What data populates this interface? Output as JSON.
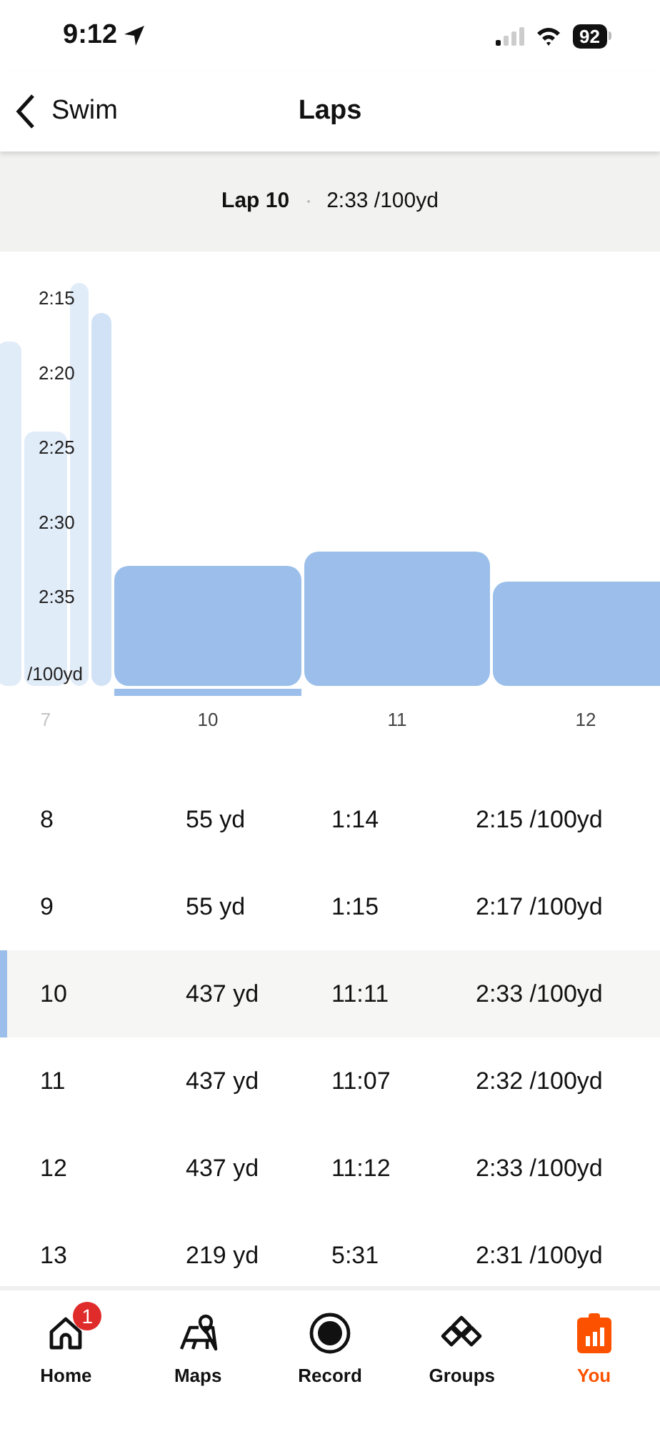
{
  "status_bar": {
    "time": "9:12",
    "battery": "92"
  },
  "header": {
    "back_label": "Swim",
    "title": "Laps"
  },
  "summary": {
    "lap": "Lap 10",
    "pace": "2:33 /100yd"
  },
  "chart": {
    "unit": "/100yd",
    "y_labels": [
      "2:15",
      "2:20",
      "2:25",
      "2:30",
      "2:35"
    ],
    "bars": [
      {
        "selected": false
      },
      {
        "label": "7",
        "selected": false
      },
      {
        "selected": false
      },
      {
        "selected": false
      },
      {
        "label": "10",
        "selected": true
      },
      {
        "label": "11",
        "selected": false
      },
      {
        "label": "12",
        "selected": false
      }
    ]
  },
  "rows": [
    {
      "lap": "8",
      "distance": "55 yd",
      "time": "1:14",
      "pace": "2:15 /100yd",
      "selected": false
    },
    {
      "lap": "9",
      "distance": "55 yd",
      "time": "1:15",
      "pace": "2:17 /100yd",
      "selected": false
    },
    {
      "lap": "10",
      "distance": "437 yd",
      "time": "11:11",
      "pace": "2:33 /100yd",
      "selected": true
    },
    {
      "lap": "11",
      "distance": "437 yd",
      "time": "11:07",
      "pace": "2:32 /100yd",
      "selected": false
    },
    {
      "lap": "12",
      "distance": "437 yd",
      "time": "11:12",
      "pace": "2:33 /100yd",
      "selected": false
    },
    {
      "lap": "13",
      "distance": "219 yd",
      "time": "5:31",
      "pace": "2:31 /100yd",
      "selected": false
    }
  ],
  "tabs": [
    {
      "label": "Home",
      "selected": false,
      "badge": "1"
    },
    {
      "label": "Maps",
      "selected": false
    },
    {
      "label": "Record",
      "selected": false
    },
    {
      "label": "Groups",
      "selected": false
    },
    {
      "label": "You",
      "selected": true
    }
  ]
}
